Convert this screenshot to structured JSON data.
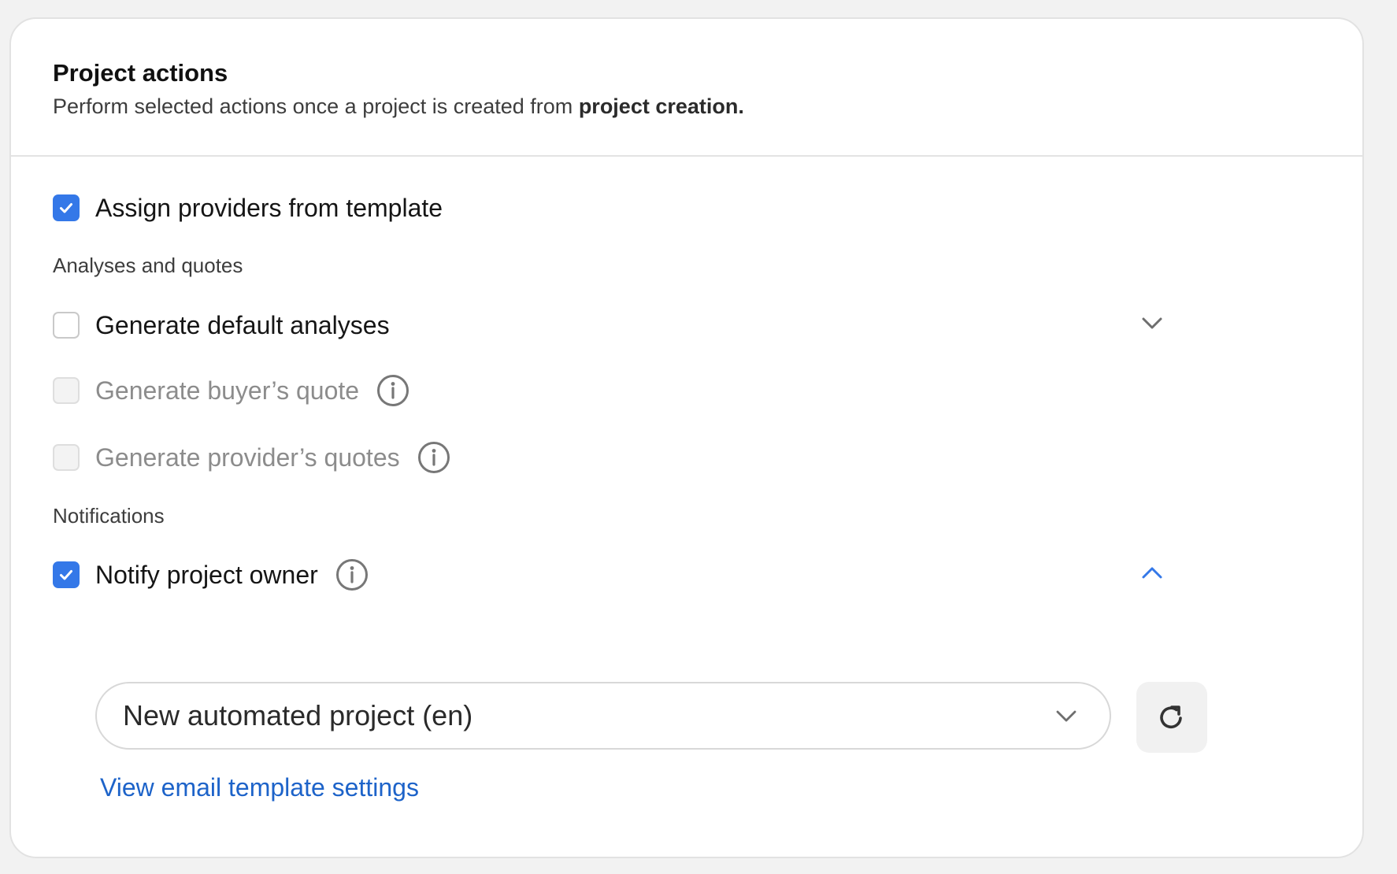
{
  "header": {
    "title": "Project actions",
    "subtitle_prefix": "Perform selected actions once a project is created from ",
    "subtitle_bold": "project creation."
  },
  "assign_providers": {
    "label": "Assign providers from template",
    "checked": true
  },
  "analyses_section": {
    "label": "Analyses and quotes",
    "items": [
      {
        "label": "Generate default analyses",
        "checked": false,
        "disabled": false,
        "info": false,
        "expand": "chevron-down-icon"
      },
      {
        "label": "Generate buyer’s quote",
        "checked": false,
        "disabled": true,
        "info": true
      },
      {
        "label": "Generate provider’s quotes",
        "checked": false,
        "disabled": true,
        "info": true
      }
    ]
  },
  "notifications_section": {
    "label": "Notifications",
    "notify_owner": {
      "label": "Notify project owner",
      "checked": true,
      "info": true,
      "expand": "chevron-up-icon"
    },
    "template_select": {
      "value": "New automated project (en)"
    },
    "refresh_icon": "refresh-icon",
    "link": "View email template settings"
  },
  "colors": {
    "checkbox_checked": "#3478e8",
    "link": "#1d63c9",
    "chevron_active": "#3478e8",
    "disabled_text": "#8c8c8c"
  }
}
